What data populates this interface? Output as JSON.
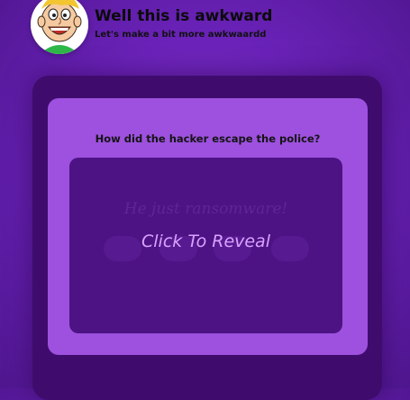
{
  "header": {
    "title": "Well this is awkward",
    "subtitle": "Let's make a bit more awkwaardd",
    "avatar_icon": "cartoon-boy-face-icon"
  },
  "card": {
    "question": "How did the hacker escape the police?",
    "answer_hidden": "He just ransomware!",
    "reveal_label": "Click To Reveal"
  },
  "colors": {
    "background": "#6a22b8",
    "outer_panel": "#3f0c6e",
    "card": "#9d51de",
    "answer_box": "#4d1384",
    "reveal_text": "#d8a3ff"
  }
}
